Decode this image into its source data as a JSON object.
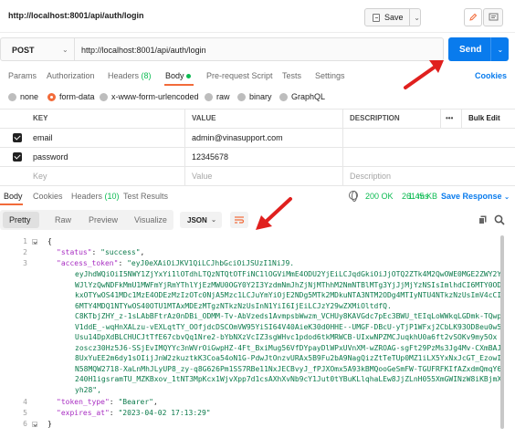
{
  "title_bar": {
    "url": "http://localhost:8001/api/auth/login",
    "save_label": "Save"
  },
  "request": {
    "method": "POST",
    "url": "http://localhost:8001/api/auth/login",
    "send_label": "Send"
  },
  "request_tabs": {
    "params": "Params",
    "authorization": "Authorization",
    "headers": "Headers",
    "headers_count": "(8)",
    "body": "Body",
    "pre_request": "Pre-request Script",
    "tests": "Tests",
    "settings": "Settings",
    "cookies": "Cookies"
  },
  "body_types": {
    "none": "none",
    "form_data": "form-data",
    "urlencoded": "x-www-form-urlencoded",
    "raw": "raw",
    "binary": "binary",
    "graphql": "GraphQL",
    "selected": "form-data"
  },
  "kv_table": {
    "headers": {
      "key": "KEY",
      "value": "VALUE",
      "description": "DESCRIPTION",
      "more": "•••",
      "bulk_edit": "Bulk Edit"
    },
    "rows": [
      {
        "key": "email",
        "value": "admin@vinasupport.com",
        "checked": true
      },
      {
        "key": "password",
        "value": "12345678",
        "checked": true
      }
    ],
    "placeholders": {
      "key": "Key",
      "value": "Value",
      "description": "Description"
    }
  },
  "response_tabs": {
    "body": "Body",
    "cookies": "Cookies",
    "headers": "Headers",
    "headers_count": "(10)",
    "test_results": "Test Results",
    "status": "200 OK",
    "time": "261 ms",
    "size": "1.45 KB",
    "save_response": "Save Response"
  },
  "response_view": {
    "pretty": "Pretty",
    "raw": "Raw",
    "preview": "Preview",
    "visualize": "Visualize",
    "format": "JSON"
  },
  "code": {
    "line_numbers": [
      "1",
      "2",
      "3",
      "4",
      "5",
      "6"
    ],
    "open_brace": "{",
    "status_key": "\"status\"",
    "status_val": "\"success\"",
    "token_key": "\"access_token\"",
    "token_lines": [
      "\"eyJ0eXAiOiJKV1QiLCJhbGciOiJSUzI1NiJ9.",
      "eyJhdWQiOiI5NWY1ZjYxYi1lOTdhLTQzNTQtOTFiNC1lOGViMmE4ODU2YjEiLCJqdGkiOiJjOTQ2ZTk4M2QwOWE0MGE2ZWY2Y",
      "WJlYzQwNDFkMmU1MWFmYjRmYThlYjEzMWU0OGY0Y2I3YzdmNmJhZjNjMThhM2NmNTBlMTg3YjJjMjYzNSIsImlhdCI6MTY0OD",
      "kxOTYwOS41MDc1MzE4ODEzMzIzOTc0NjA5Mzc1LCJuYmYiOjE2NDg5MTk2MDkuNTA3NTM2ODg4MTIyNTU4NTkzNzUsImV4cCI",
      "6MTY4MDQ1NTYwOS40OTU1MTAxMDEzMTgzNTkzNzUsInN1YiI6IjEiLCJzY29wZXMiOltdfQ.",
      "C8KTbjZHY_z-1sLAbBFtrAz0nDBi_ODMM-Tv-AbVzeds1AvmpsbWwzm_VCHUy8KAVGdc7pEc3BWU_tEIqLoWWkqLGDmk-TQwp",
      "V1ddE_-wqHnXALzu-vEXLqtTY_OOfjdcDSCOmVW95YiSI64V40AieK30d0HHE--UMGF-DBcU-yTjP1WFxj2CbLK93OD8eu0w5",
      "Usu14DpXdBLCHUCJtTfE67cbvQq1Nre2-bYbNXzVcIZ3sgWHvc1pdod6tkMRWCB-UIxwNPZMCJuqkhU0a6ft2vSOKv9my5Ox",
      "zoscz30Hz5J6-SSjEvIMQYYc3nWVrOiGwpHZ-4Ft_BxiMug56VfDYpayDlWPxUVnXM-wZROAG-sgFt29PzMs3Jg4Mv-CXmBAJ",
      "8UxYuEE2m6dy1sOIijJnW2zkuztkK3Coa54oN1G-PdwJtOnzvURAx5B9Fu2bA9NagQizZtTeTUp0MZ1iLX5YxNxJcGT_EzowI",
      "N58MQW2718-XaLnMhJLyUP8_zy-q8G626Pm1SS7RBe11NxJECBvyJ_fPJXOmx5A93kBMQooGeSmFW-TGUFRFKIfAZxdmQmqY6",
      "240H1igsramTU_MZKBxov_1tNT3MpKcx1WjvXpp7d1csAXhXvNb9cY1Jut0tYBuKLlqhaLEw8JjZLnH055XmGWINzW8iKBjmX",
      "yh28\","
    ],
    "token_type_key": "\"token_type\"",
    "token_type_val": "\"Bearer\"",
    "expires_key": "\"expires_at\"",
    "expires_val": "\"2023-04-02 17:13:29\"",
    "close_brace": "}"
  },
  "colors": {
    "accent_orange": "#f26b3a",
    "send_blue": "#097bed",
    "status_green": "#0cbb52",
    "json_key_purple": "#a82dc2",
    "json_string_green": "#0b7a4b",
    "annotation_red": "#e0201e"
  }
}
